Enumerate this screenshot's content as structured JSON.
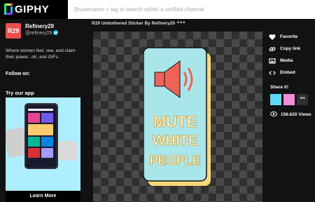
{
  "header": {
    "logo_text": "GIPHY",
    "search_placeholder": "@username + tag to search within a verified channel"
  },
  "channel": {
    "name": "Refinery29",
    "handle": "@refinery29",
    "avatar_text": "R29",
    "bio": "Where women feel, see, and claim their power...oh, and GIFs.",
    "follow_label": "Follow on:",
    "try_app_label": "Try our app",
    "learn_more_label": "Learn More"
  },
  "gif": {
    "title": "R29 Unbothered Sticker By Refinery29",
    "more_label": "•••",
    "sticker_lines": [
      "MUTE",
      "WHITE",
      "PEOPLE"
    ]
  },
  "actions": [
    {
      "label": "Favorite",
      "icon": "heart-icon"
    },
    {
      "label": "Copy link",
      "icon": "link-icon"
    },
    {
      "label": "Media",
      "icon": "media-icon"
    },
    {
      "label": "Embed",
      "icon": "embed-icon"
    }
  ],
  "share": {
    "label": "Share it!",
    "more_label": "•••",
    "colors": [
      "#61d8f2",
      "#f08ed9",
      "#303030"
    ]
  },
  "views": {
    "text": "156.620 Views"
  },
  "colors": {
    "accent_pink": "#ec4d4d",
    "verified_blue": "#15cdff",
    "sticker_bg": "#a9e6ea",
    "speaker_red": "#ef6357",
    "sticker_shadow": "#f5d87a"
  }
}
